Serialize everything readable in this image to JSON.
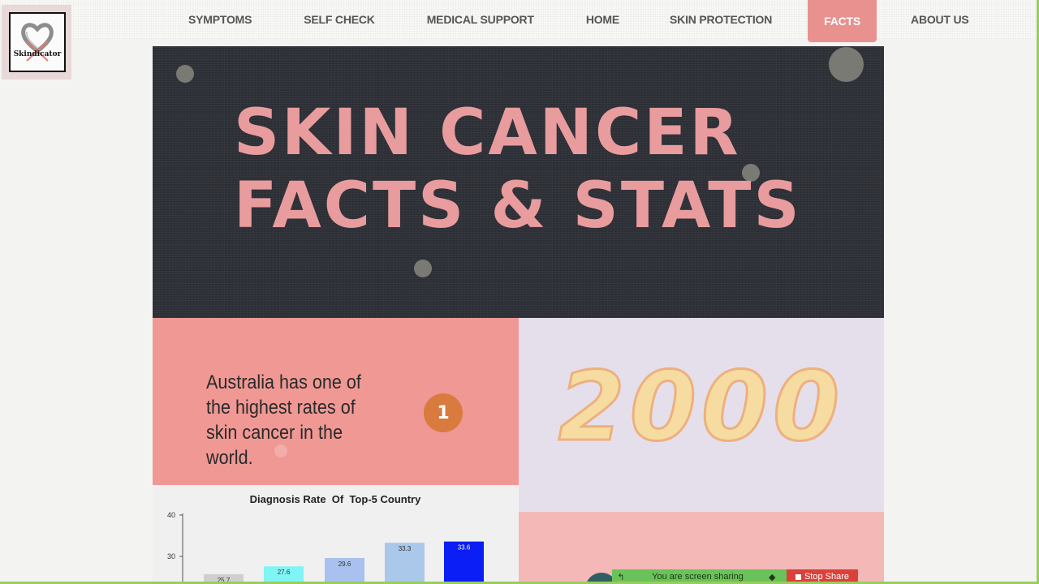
{
  "logo": {
    "text": "Skindicator"
  },
  "nav": {
    "items": [
      {
        "label": "SYMPTOMS",
        "active": false
      },
      {
        "label": "SELF CHECK",
        "active": false
      },
      {
        "label": "MEDICAL SUPPORT",
        "active": false
      },
      {
        "label": "HOME",
        "active": false
      },
      {
        "label": "SKIN PROTECTION",
        "active": false
      },
      {
        "label": "FACTS",
        "active": true
      },
      {
        "label": "ABOUT US",
        "active": false
      }
    ]
  },
  "hero": {
    "line1": "SKIN CANCER",
    "line2": "FACTS & STATS"
  },
  "fact1": {
    "text": "Australia has one of the highest rates of skin cancer in the world.",
    "badge": "1"
  },
  "fact2": {
    "number": "2000"
  },
  "chart_data": {
    "type": "bar",
    "title": "Diagnosis Rate  Of  Top-5 Country",
    "categories": [
      "",
      "",
      "",
      "",
      ""
    ],
    "values": [
      25.7,
      27.6,
      29.6,
      33.3,
      33.6
    ],
    "value_labels": [
      "25.7",
      "27.6",
      "29.6",
      "33.3",
      "33.6"
    ],
    "colors": [
      "#cfcfcf",
      "#7ff5f5",
      "#a9c1ee",
      "#a9c8ea",
      "#0a1ef5"
    ],
    "label_colors": [
      "#333333",
      "#333333",
      "#333333",
      "#333333",
      "#ffffff"
    ],
    "yticks": [
      "40",
      "30"
    ],
    "ylim": [
      20,
      40
    ],
    "xlabel": "",
    "ylabel": ""
  },
  "share_bar": {
    "message": "You are screen sharing",
    "stop_label": "Stop Share"
  },
  "colors": {
    "accent": "#e8918f",
    "hero_bg": "#2d2f36",
    "hero_text": "#e89c9e"
  }
}
